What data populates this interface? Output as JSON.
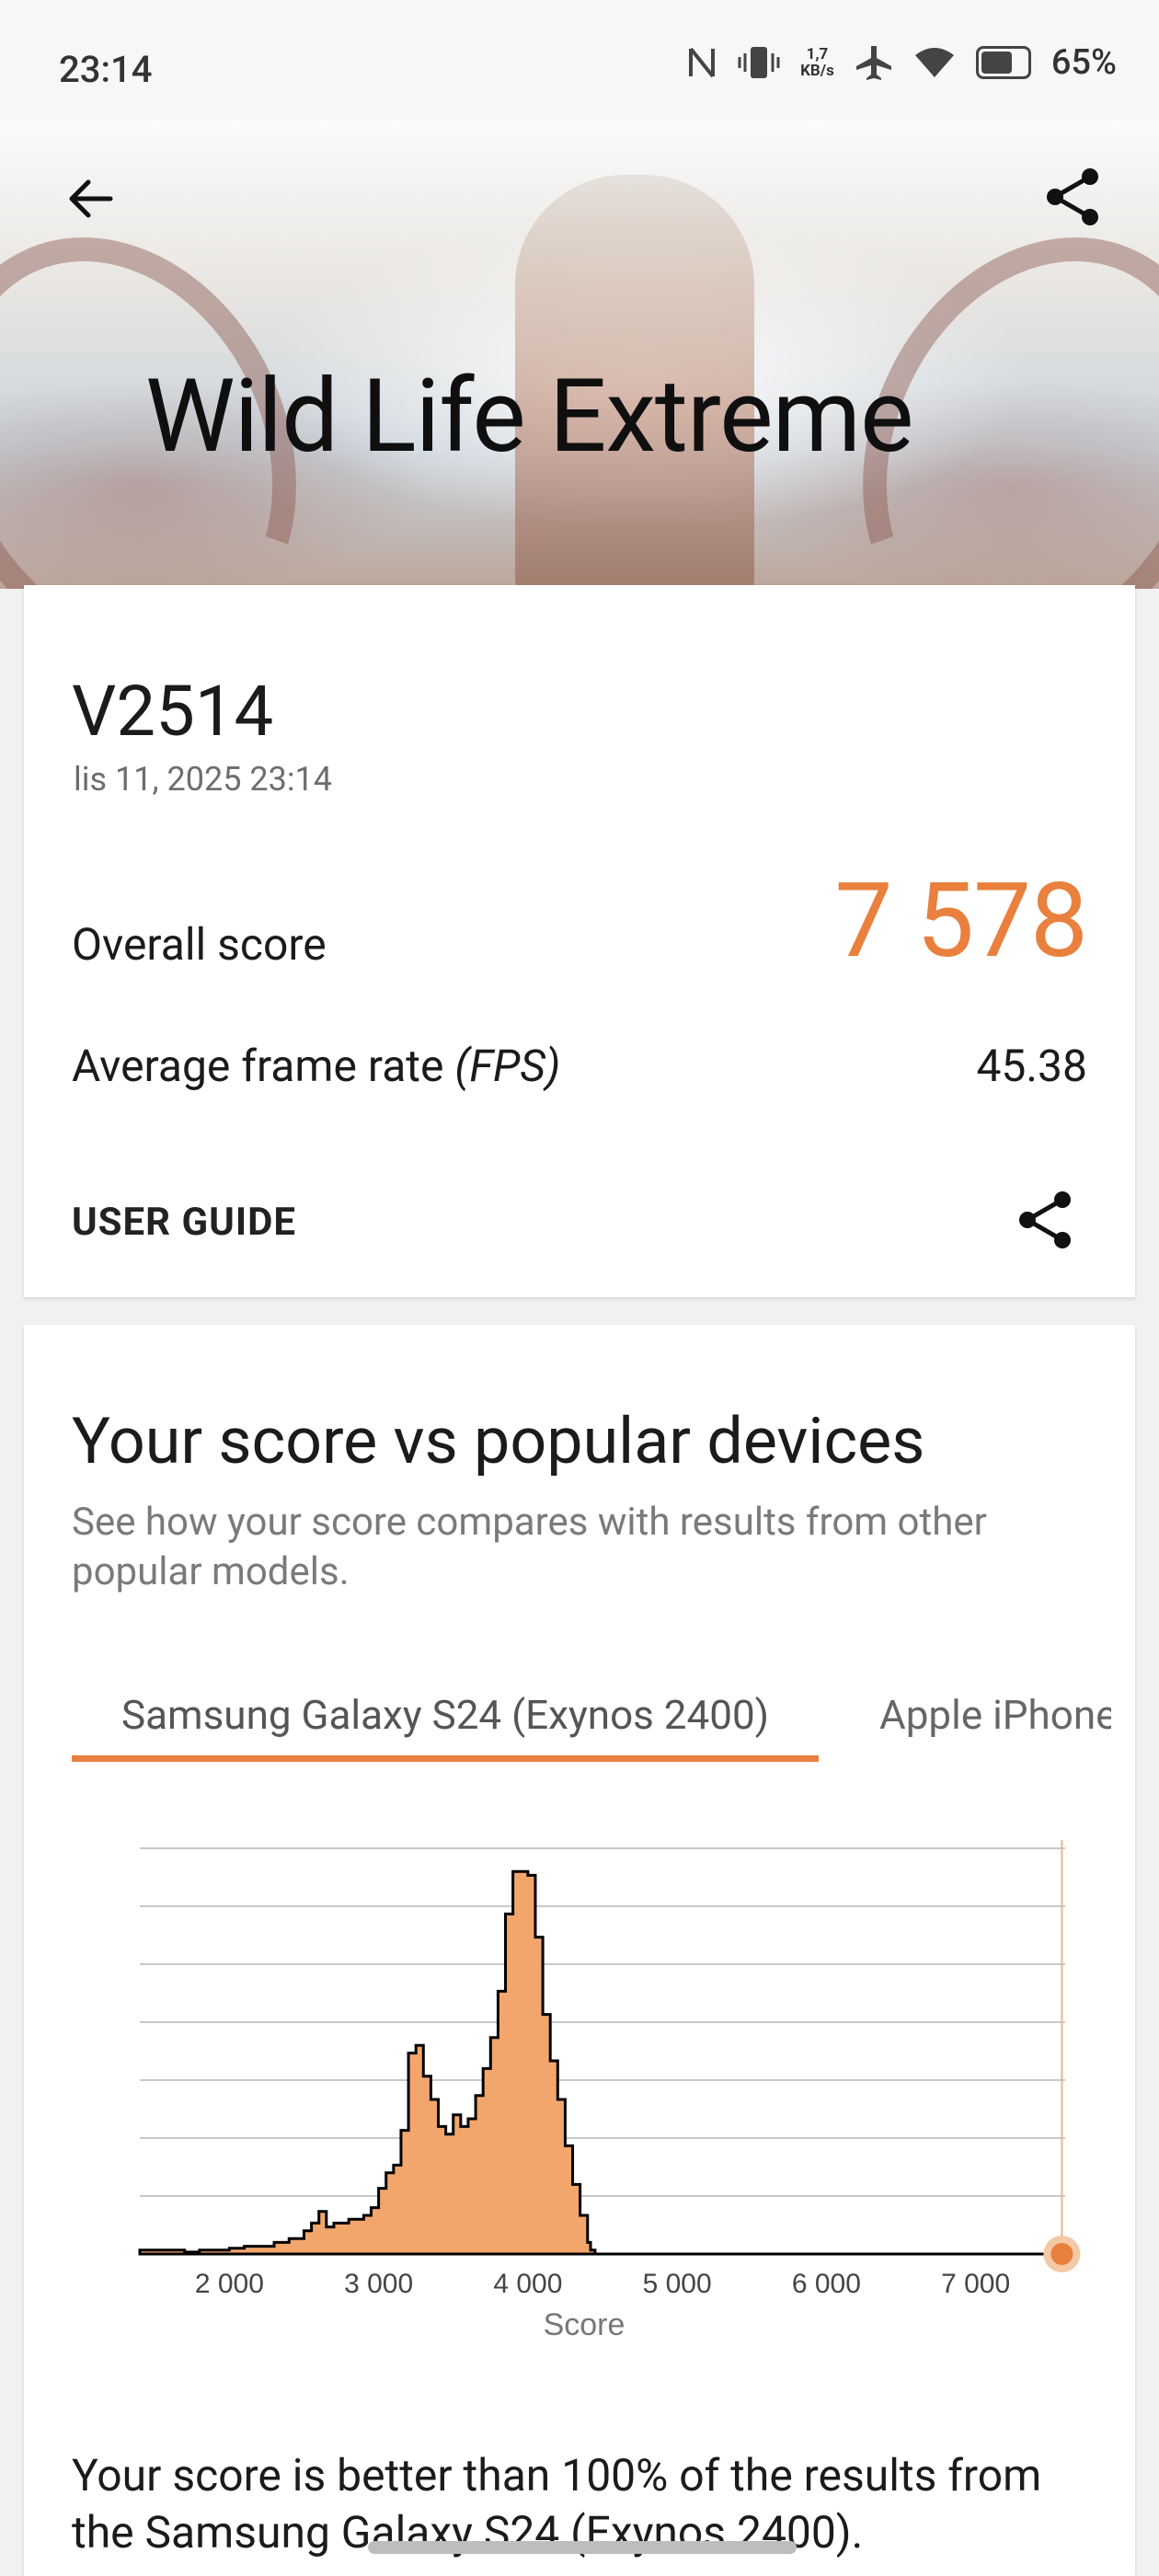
{
  "status_bar": {
    "time": "23:14",
    "network_speed_value": "1,7",
    "network_speed_unit": "KB/s",
    "battery": "65%",
    "icons": [
      "nfc-icon",
      "vibrate-icon",
      "airplane-icon",
      "wifi-icon",
      "battery-icon"
    ]
  },
  "header": {
    "title": "Wild Life Extreme",
    "back_icon": "arrow-left-icon",
    "share_icon": "share-icon"
  },
  "result_card": {
    "device": "V2514",
    "date": "lis 11, 2025 23:14",
    "overall_label": "Overall score",
    "overall_value": "7 578",
    "fps_label": "Average frame rate ",
    "fps_unit": "(FPS)",
    "fps_value": "45.38",
    "user_guide": "USER GUIDE",
    "accent_color": "#e9803d"
  },
  "comparison": {
    "title": "Your score vs popular devices",
    "subtitle": "See how your score compares with results from other popular models.",
    "tabs": [
      {
        "label": "Samsung Galaxy S24 (Exynos 2400)",
        "active": true
      },
      {
        "label": "Apple iPhone",
        "active": false
      }
    ],
    "result_text": "Your score is better than 100% of the results from the Samsung Galaxy S24 (Exynos 2400)."
  },
  "chart_data": {
    "type": "area",
    "title": "",
    "xlabel": "Score",
    "ylabel": "",
    "xlim": [
      1400,
      7600
    ],
    "ylim": [
      0,
      100
    ],
    "x_ticks": [
      2000,
      3000,
      4000,
      5000,
      6000,
      7000
    ],
    "x_tick_labels": [
      "2 000",
      "3 000",
      "4 000",
      "5 000",
      "6 000",
      "7 000"
    ],
    "grid": true,
    "fill_color": "#f2a66c",
    "line_color": "#000000",
    "series": [
      {
        "x": [
          1400,
          1500,
          1600,
          1700,
          1800,
          1900,
          2000,
          2100,
          2200,
          2300,
          2400,
          2500,
          2550,
          2600,
          2650,
          2700,
          2800,
          2900,
          2950,
          3000,
          3050,
          3100,
          3150,
          3200,
          3250,
          3300,
          3350,
          3400,
          3450,
          3500,
          3550,
          3600,
          3650,
          3700,
          3750,
          3800,
          3850,
          3900,
          3950,
          4000,
          4050,
          4100,
          4150,
          4200,
          4250,
          4300,
          4350,
          4400,
          4420,
          4450,
          4600,
          5000,
          6000,
          7000,
          7600
        ],
        "y": [
          1,
          1,
          1,
          0.5,
          1,
          1,
          1.5,
          2,
          2,
          3,
          4,
          6,
          8,
          11,
          7,
          8,
          9,
          10,
          12,
          17,
          21,
          23,
          32,
          52,
          54,
          46,
          40,
          33,
          31,
          36,
          33,
          35,
          41,
          48,
          56,
          68,
          88,
          99,
          99,
          98,
          82,
          62,
          50,
          40,
          28,
          18,
          10,
          3,
          1,
          0,
          0,
          0,
          0,
          0,
          0
        ]
      }
    ],
    "your_score": 7578,
    "your_score_color": "#e9803d"
  }
}
